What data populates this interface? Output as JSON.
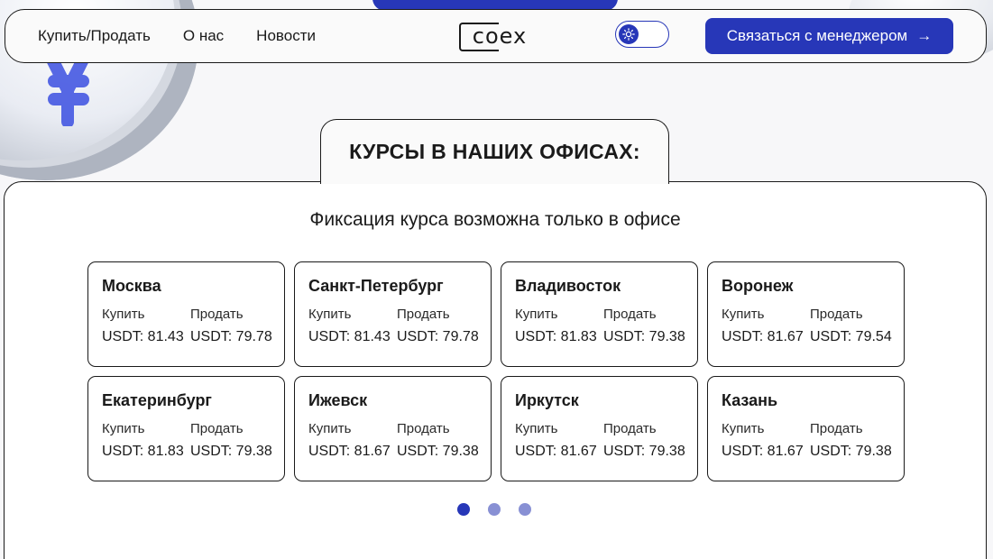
{
  "header": {
    "nav": [
      {
        "label": "Купить/Продать"
      },
      {
        "label": "О нас"
      },
      {
        "label": "Новости"
      }
    ],
    "logo_text": "coex",
    "contact_button": "Связаться с менеджером",
    "contact_button_arrow": "→"
  },
  "section": {
    "title": "КУРСЫ В НАШИХ ОФИСАХ:",
    "subtitle": "Фиксация курса возможна только в офисе"
  },
  "offices": [
    {
      "city": "Москва",
      "buy_label": "Купить",
      "sell_label": "Продать",
      "buy": "USDT: 81.43",
      "sell": "USDT: 79.78"
    },
    {
      "city": "Санкт-Петербург",
      "buy_label": "Купить",
      "sell_label": "Продать",
      "buy": "USDT: 81.43",
      "sell": "USDT: 79.78"
    },
    {
      "city": "Владивосток",
      "buy_label": "Купить",
      "sell_label": "Продать",
      "buy": "USDT: 81.83",
      "sell": "USDT: 79.38"
    },
    {
      "city": "Воронеж",
      "buy_label": "Купить",
      "sell_label": "Продать",
      "buy": "USDT: 81.67",
      "sell": "USDT: 79.54"
    },
    {
      "city": "Екатеринбург",
      "buy_label": "Купить",
      "sell_label": "Продать",
      "buy": "USDT: 81.83",
      "sell": "USDT: 79.38"
    },
    {
      "city": "Ижевск",
      "buy_label": "Купить",
      "sell_label": "Продать",
      "buy": "USDT: 81.67",
      "sell": "USDT: 79.38"
    },
    {
      "city": "Иркутск",
      "buy_label": "Купить",
      "sell_label": "Продать",
      "buy": "USDT: 81.67",
      "sell": "USDT: 79.38"
    },
    {
      "city": "Казань",
      "buy_label": "Купить",
      "sell_label": "Продать",
      "buy": "USDT: 81.67",
      "sell": "USDT: 79.38"
    }
  ],
  "pagination": {
    "pages": 3,
    "active": 0
  },
  "colors": {
    "accent": "#2737b8",
    "dot_inactive": "#8890d4"
  },
  "icons": {
    "theme": "sun-icon",
    "arrow": "arrow-right-icon"
  }
}
